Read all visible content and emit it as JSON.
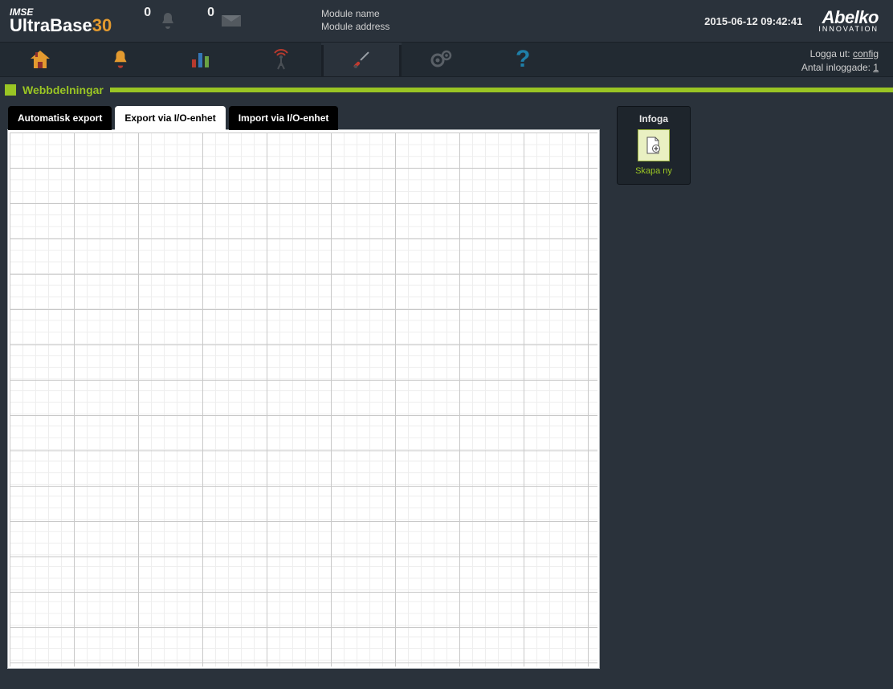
{
  "brand": {
    "top": "IMSE",
    "bottom_main": "UltraBase",
    "bottom_suffix": "30"
  },
  "header": {
    "bell_count": "0",
    "mail_count": "0",
    "module_name_label": "Module name",
    "module_address_label": "Module address",
    "datetime": "2015-06-12 09:42:41",
    "logo_big": "Abelko",
    "logo_small": "INNOVATION"
  },
  "nav": {
    "logout_label": "Logga ut:",
    "logout_user": "config",
    "logged_in_label": "Antal inloggade:",
    "logged_in_count": "1"
  },
  "section": {
    "title": "Webbdelningar"
  },
  "tabs": {
    "auto_export": "Automatisk export",
    "export_io": "Export via I/O-enhet",
    "import_io": "Import via I/O-enhet"
  },
  "side_panel": {
    "title": "Infoga",
    "create_label": "Skapa ny"
  }
}
